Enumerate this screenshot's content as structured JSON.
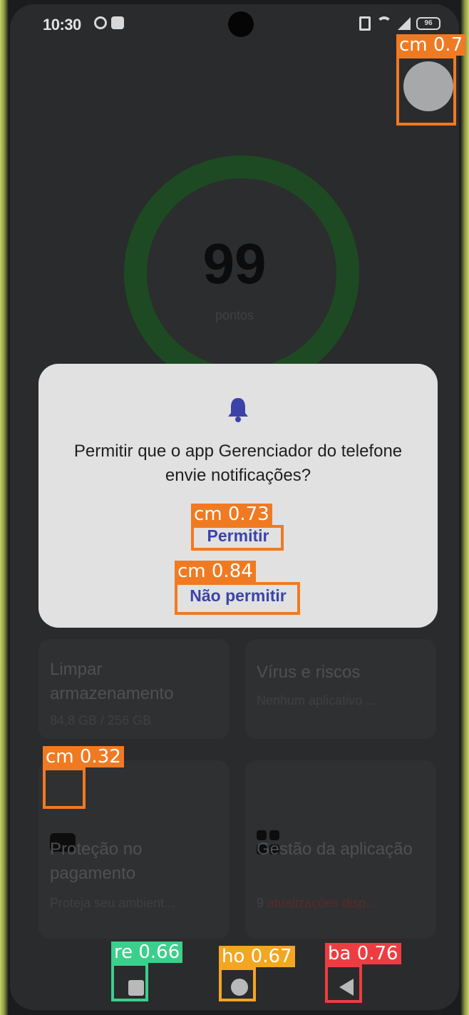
{
  "status_bar": {
    "time": "10:30",
    "battery": "96"
  },
  "score": {
    "value": "99",
    "unit": "pontos"
  },
  "dialog": {
    "icon": "bell-icon",
    "title": "Permitir que o app Gerenciador do telefone envie notificações?",
    "allow_label": "Permitir",
    "deny_label": "Não permitir",
    "accent_color": "#3b43a8"
  },
  "cards": [
    {
      "title": "Limpar armazenamento",
      "subtitle": "84,8 GB / 256 GB"
    },
    {
      "title": "Vírus e riscos",
      "subtitle": "Nenhum aplicativo ..."
    },
    {
      "title": "Proteção no pagamento",
      "subtitle": "Proteja seu ambient..."
    },
    {
      "title": "Gestão da aplicação",
      "subtitle_count": "9",
      "subtitle_warn": "atualizações disp..."
    }
  ],
  "navigation": {
    "recents": "recents-button",
    "home": "home-button",
    "back": "back-button"
  },
  "detections": [
    {
      "label": "cm 0.7",
      "color": "#f07a22"
    },
    {
      "label": "cm 0.73",
      "color": "#f07a22"
    },
    {
      "label": "cm 0.84",
      "color": "#f07a22"
    },
    {
      "label": "cm 0.32",
      "color": "#f07a22"
    },
    {
      "label": "re 0.66",
      "color": "#3ccf8c"
    },
    {
      "label": "ho 0.67",
      "color": "#f4a522"
    },
    {
      "label": "ba 0.76",
      "color": "#ee3d42"
    }
  ]
}
